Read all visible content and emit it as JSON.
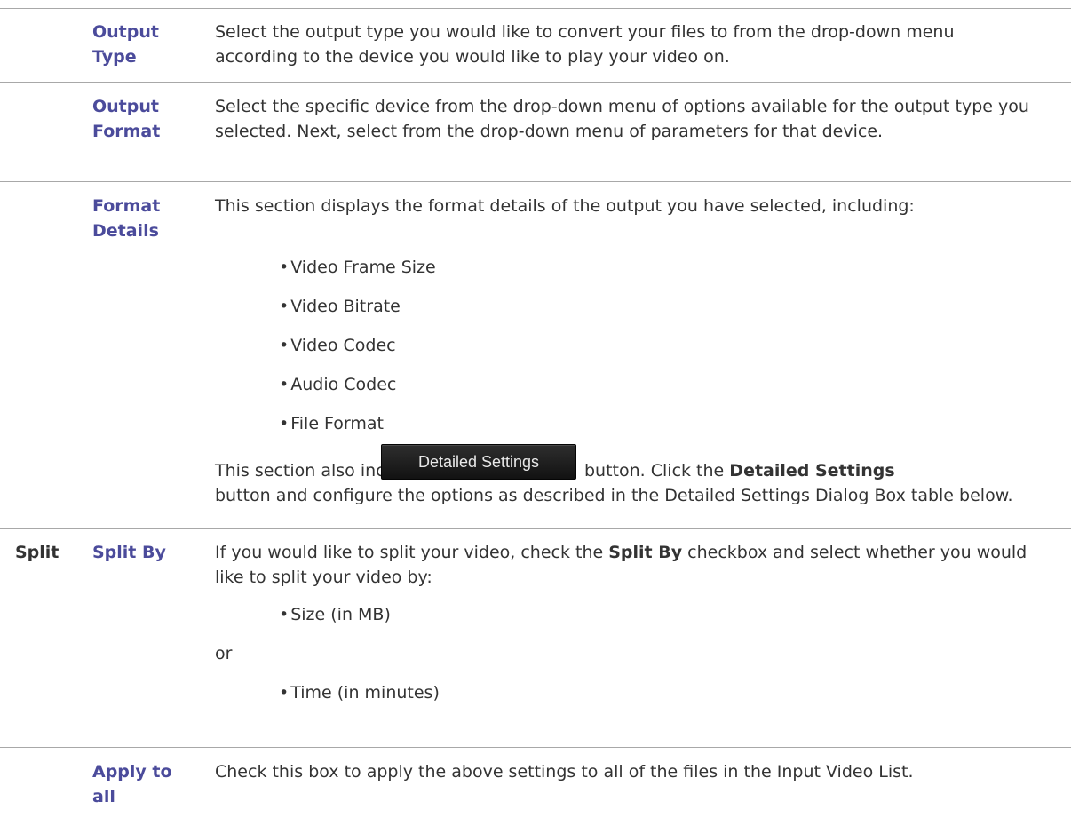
{
  "rows": [
    {
      "term": "Output Type",
      "description": "Select the output type you would like to convert your files to from the drop-down menu according to the device you would like to play your video on."
    },
    {
      "term": "Output Format",
      "description": "Select the specific device from the drop-down menu of options available for the output type you selected. Next, select from the drop-down menu of parameters for that device."
    },
    {
      "term": "Format Details",
      "intro": "This section displays the format details of the output you have selected, including:",
      "bullets": [
        "Video Frame Size",
        "Video Bitrate",
        "Video Codec",
        "Audio Codec",
        "File Format"
      ],
      "after_pre": "This section also includes the",
      "button_label": "Detailed Settings",
      "after_mid": "button. Click the",
      "after_bold": "Detailed Settings",
      "after_post": "button and configure the options as described in the Detailed Settings Dialog Box table below."
    },
    {
      "category": "Split",
      "term": "Split By",
      "intro_pre": "If you would like to split your video, check the",
      "intro_bold": "Split By",
      "intro_post": "checkbox and select whether you would like to split your video by:",
      "bullets": [
        "Size (in MB)",
        "Time (in minutes)"
      ],
      "connector": "or"
    },
    {
      "term": "Apply to all",
      "description": "Check this box to apply the above settings to all of the files in the Input Video List."
    }
  ]
}
